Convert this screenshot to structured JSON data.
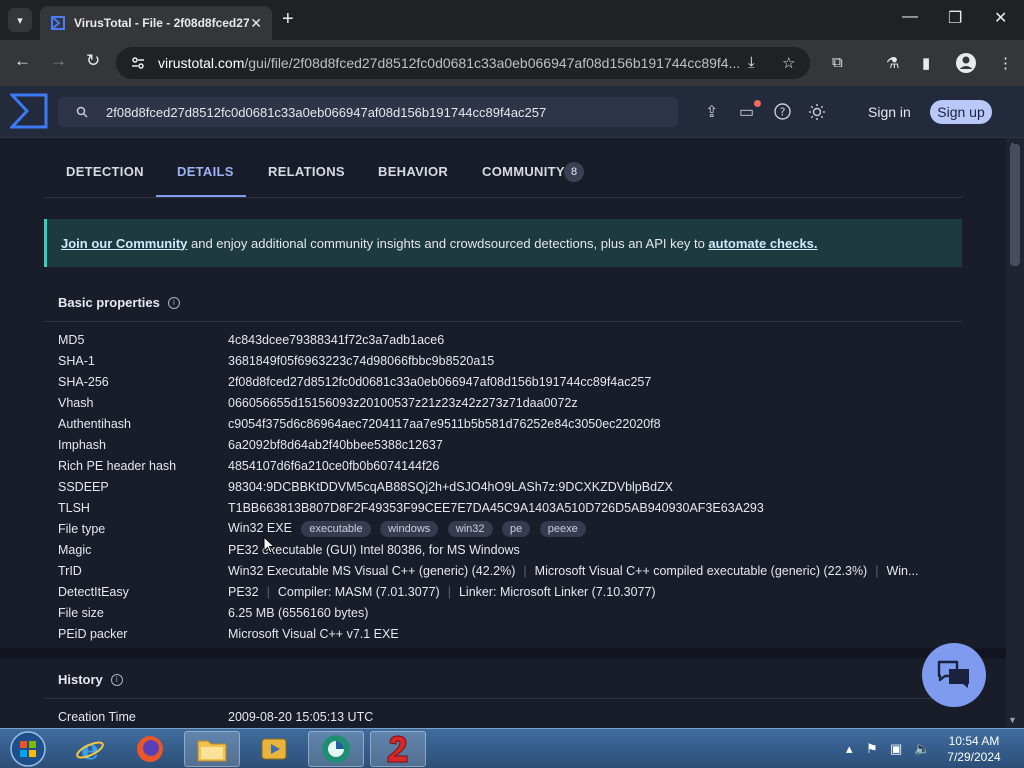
{
  "browser": {
    "tab_title": "VirusTotal - File - 2f08d8fced27",
    "tab_close": "✕",
    "new_tab": "+",
    "url_host": "virustotal.com",
    "url_path": "/gui/file/2f08d8fced27d8512fc0d0681c33a0eb066947af08d156b191744cc89f4...",
    "window_controls": {
      "minimize": "—",
      "restore": "❐",
      "close": "✕"
    }
  },
  "vt_header": {
    "search_value": "2f08d8fced27d8512fc0d0681c33a0eb066947af08d156b191744cc89f4ac257",
    "sign_in": "Sign in",
    "sign_up": "Sign up"
  },
  "tabs": [
    {
      "label": "DETECTION"
    },
    {
      "label": "DETAILS"
    },
    {
      "label": "RELATIONS"
    },
    {
      "label": "BEHAVIOR"
    },
    {
      "label": "COMMUNITY"
    }
  ],
  "community_count": "8",
  "banner": {
    "link1": "Join our Community",
    "middle": " and enjoy additional community insights and crowdsourced detections, plus an API key to ",
    "link2": "automate checks."
  },
  "basic_properties": {
    "title": "Basic properties",
    "rows": [
      {
        "key": "MD5",
        "value": "4c843dcee79388341f72c3a7adb1ace6"
      },
      {
        "key": "SHA-1",
        "value": "3681849f05f6963223c74d98066fbbc9b8520a15"
      },
      {
        "key": "SHA-256",
        "value": "2f08d8fced27d8512fc0d0681c33a0eb066947af08d156b191744cc89f4ac257"
      },
      {
        "key": "Vhash",
        "value": "066056655d15156093z20100537z21z23z42z273z71daa0072z"
      },
      {
        "key": "Authentihash",
        "value": "c9054f375d6c86964aec7204117aa7e9511b5b581d76252e84c3050ec22020f8"
      },
      {
        "key": "Imphash",
        "value": "6a2092bf8d64ab2f40bbee5388c12637"
      },
      {
        "key": "Rich PE header hash",
        "value": "4854107d6f6a210ce0fb0b6074144f26"
      },
      {
        "key": "SSDEEP",
        "value": "98304:9DCBBKtDDVM5cqAB88SQj2h+dSJO4hO9LASh7z:9DCXKZDVblpBdZX"
      },
      {
        "key": "TLSH",
        "value": "T1BB663813B807D8F2F49353F99CEE7E7DA45C9A1403A510D726D5AB940930AF3E63A293"
      }
    ],
    "file_type": {
      "key": "File type",
      "value": "Win32 EXE",
      "tags": [
        "executable",
        "windows",
        "win32",
        "pe",
        "peexe"
      ]
    },
    "magic": {
      "key": "Magic",
      "value": "PE32 executable (GUI) Intel 80386, for MS Windows"
    },
    "trid": {
      "key": "TrID",
      "parts": [
        "Win32 Executable MS Visual C++ (generic) (42.2%)",
        "Microsoft Visual C++ compiled executable (generic) (22.3%)",
        "Win..."
      ]
    },
    "die": {
      "key": "DetectItEasy",
      "parts": [
        "PE32",
        "Compiler: MASM (7.01.3077)",
        "Linker: Microsoft Linker (7.10.3077)"
      ]
    },
    "file_size": {
      "key": "File size",
      "value": "6.25 MB (6556160 bytes)"
    },
    "peid": {
      "key": "PEiD packer",
      "value": "Microsoft Visual C++ v7.1 EXE"
    }
  },
  "history": {
    "title": "History",
    "rows": [
      {
        "key": "Creation Time",
        "value": "2009-08-20 15:05:13 UTC"
      }
    ]
  },
  "taskbar": {
    "time": "10:54 AM",
    "date": "7/29/2024"
  }
}
